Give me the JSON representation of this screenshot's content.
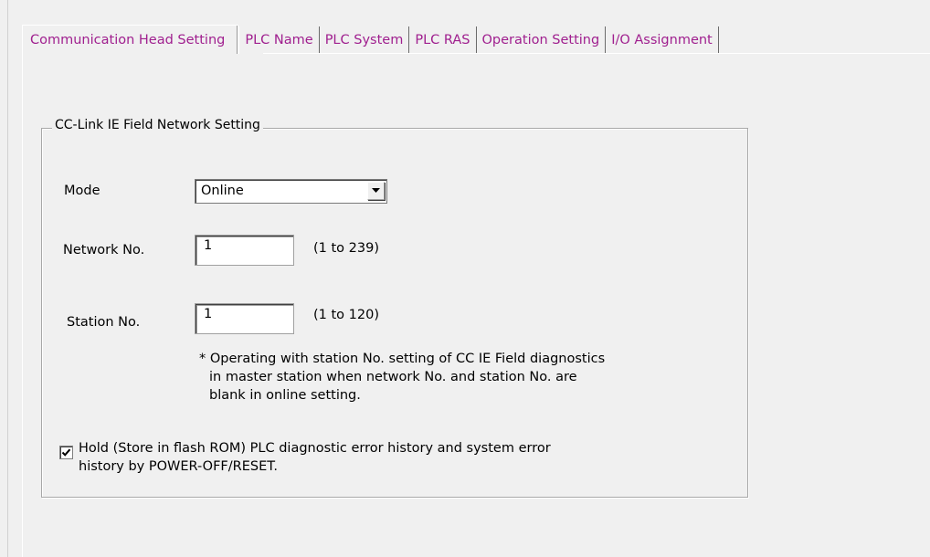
{
  "tabs": [
    {
      "label": "Communication Head Setting"
    },
    {
      "label": "PLC Name"
    },
    {
      "label": "PLC System"
    },
    {
      "label": "PLC RAS"
    },
    {
      "label": "Operation Setting"
    },
    {
      "label": "I/O Assignment"
    }
  ],
  "group": {
    "title": "CC-Link IE Field Network Setting"
  },
  "mode": {
    "label": "Mode",
    "value": "Online"
  },
  "network": {
    "label": "Network No.",
    "value": "1",
    "range": "(1 to 239)"
  },
  "station": {
    "label": "Station No.",
    "value": "1",
    "range": "(1 to 120)"
  },
  "note": {
    "line1": "* Operating with station No. setting of CC IE Field diagnostics",
    "line2": "in master station when network No. and station No. are",
    "line3": "blank in online setting."
  },
  "hold": {
    "checked": true,
    "line1": "Hold (Store in flash ROM) PLC diagnostic error history and system error",
    "line2": "history by POWER-OFF/RESET."
  },
  "colors": {
    "tab_text": "#a0208f"
  }
}
